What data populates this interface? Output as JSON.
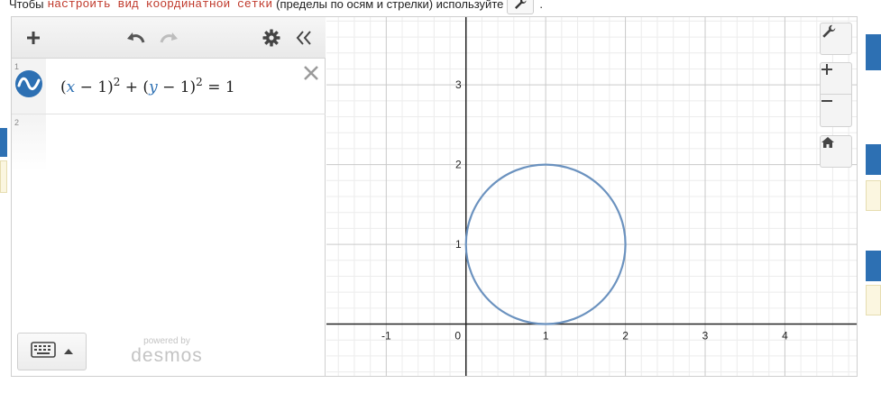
{
  "instruction": {
    "prefix": "Чтобы",
    "code": "настроить вид координатной сетки",
    "suffix": "(пределы по осям и стрелки) используйте",
    "end": ".",
    "inline_icon": "wrench-icon"
  },
  "toolbar": {
    "add_icon": "plus-icon",
    "undo_icon": "undo-icon",
    "redo_icon": "redo-icon",
    "settings_icon": "gear-icon",
    "collapse_icon": "double-chevron-left-icon"
  },
  "expressions": [
    {
      "number": "1",
      "icon": "wave-icon",
      "latex_parts": [
        "(",
        "x",
        " − 1)",
        "2",
        " + (",
        "y",
        " − 1)",
        "2",
        " = 1"
      ]
    },
    {
      "number": "2"
    }
  ],
  "footer": {
    "keyboard_icon": "keyboard-icon",
    "powered_by": "powered by",
    "brand": "desmos"
  },
  "graph_controls": [
    "wrench-icon",
    "plus-icon",
    "minus-icon",
    "home-icon"
  ],
  "colors": {
    "curve": "#6b92bf",
    "expression_icon": "#2d70b3",
    "variable": "#2d70b3",
    "code_text": "#c0392b"
  },
  "chart_data": {
    "type": "line",
    "title": "",
    "xlabel": "",
    "ylabel": "",
    "xlim": [
      -1.75,
      4.9
    ],
    "ylim": [
      -0.65,
      3.85
    ],
    "grid": true,
    "x_ticks": [
      "-1",
      "0",
      "1",
      "2",
      "3",
      "4"
    ],
    "y_ticks": [
      "1",
      "2",
      "3"
    ],
    "series": [
      {
        "kind": "circle",
        "center": [
          1,
          1
        ],
        "radius": 1
      }
    ]
  }
}
